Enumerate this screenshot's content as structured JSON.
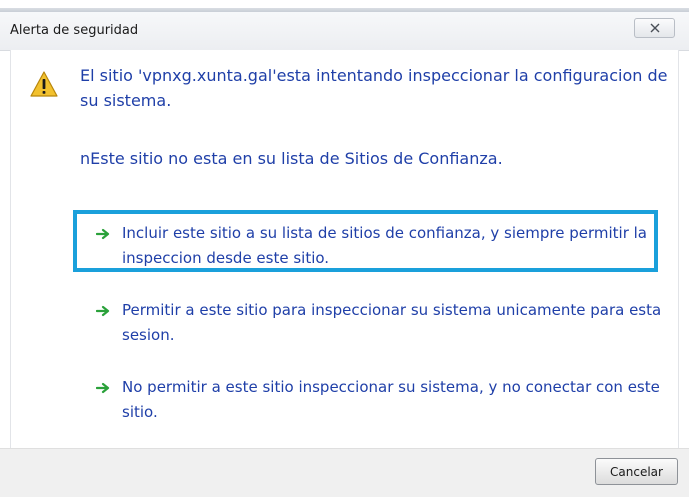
{
  "window": {
    "title": "Alerta de seguridad",
    "close_icon": "close-icon"
  },
  "message": {
    "line1": "El sitio 'vpnxg.xunta.gal'esta intentando inspeccionar la configuracion de su sistema.",
    "line2": "nEste sitio no esta en su lista de Sitios de Confianza.",
    "icon": "warning-icon"
  },
  "options": [
    {
      "label": "Incluir este sitio a su lista de sitios de confianza, y siempre permitir la inspeccion desde este sitio.",
      "highlighted": true
    },
    {
      "label": "Permitir a este sitio para inspeccionar su sistema unicamente para esta sesion.",
      "highlighted": false
    },
    {
      "label": "No permitir a este sitio inspeccionar su sistema, y no conectar con este sitio.",
      "highlighted": false
    }
  ],
  "footer": {
    "cancel_label": "Cancelar"
  },
  "colors": {
    "link_text": "#1f3fa8",
    "highlight": "#1aa0db",
    "arrow": "#2aa13a"
  }
}
